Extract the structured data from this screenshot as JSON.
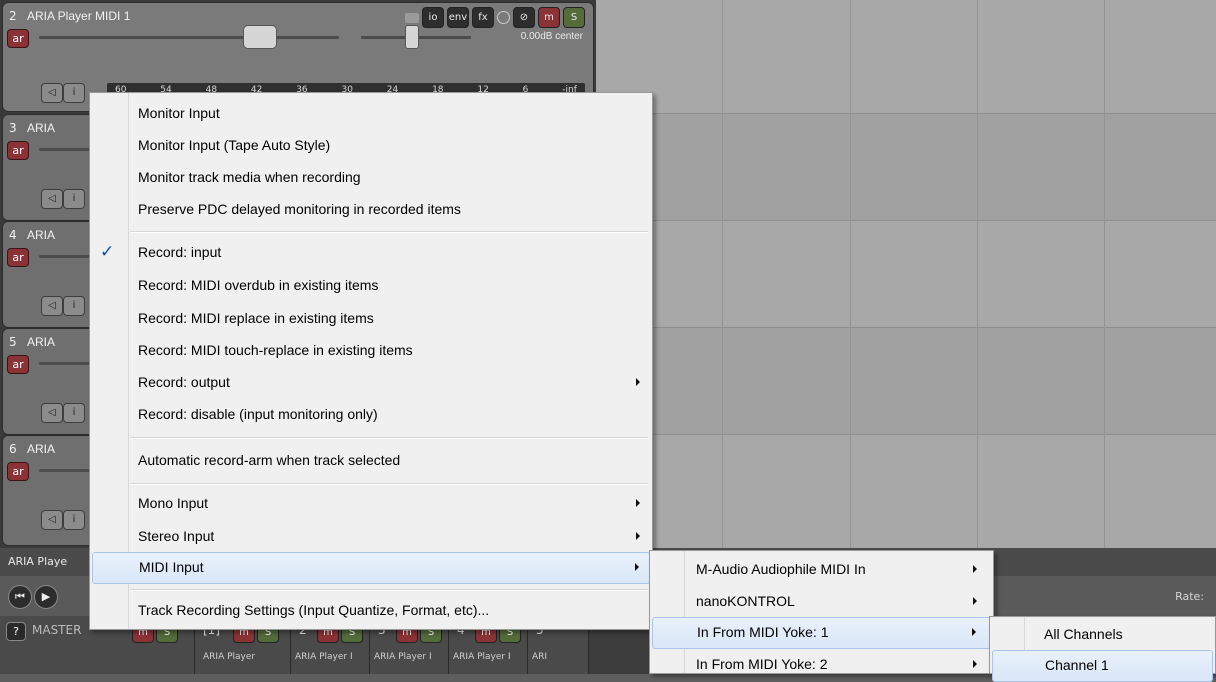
{
  "tracks": [
    {
      "num": "2",
      "name": "ARIA Player MIDI 1",
      "arm": "ar",
      "volpan": "0.00dB center",
      "buttons": {
        "io": "io",
        "env": "env",
        "fx": "fx",
        "mute": "m",
        "solo": "S"
      },
      "meter": [
        "60",
        "54",
        "48",
        "42",
        "36",
        "30",
        "24",
        "18",
        "12",
        "6",
        "-inf"
      ]
    },
    {
      "num": "3",
      "name": "ARIA",
      "arm": "ar"
    },
    {
      "num": "4",
      "name": "ARIA",
      "arm": "ar"
    },
    {
      "num": "5",
      "name": "ARIA",
      "arm": "ar"
    },
    {
      "num": "6",
      "name": "ARIA",
      "arm": "ar"
    }
  ],
  "fx_bar_label": "ARIA Playe",
  "transport": {
    "rate_label": "Rate:"
  },
  "mixer": {
    "help": "?",
    "master": "MASTER",
    "mute": "m",
    "solo": "S",
    "strips": [
      {
        "label": "[1]",
        "name": "ARIA Player"
      },
      {
        "label": "2",
        "name": "ARIA Player I"
      },
      {
        "label": "3",
        "name": "ARIA Player I"
      },
      {
        "label": "4",
        "name": "ARIA Player I"
      },
      {
        "label": "5",
        "name": "ARI"
      }
    ]
  },
  "context_menu": {
    "items": [
      {
        "label": "Monitor Input"
      },
      {
        "label": "Monitor Input (Tape Auto Style)"
      },
      {
        "label": "Monitor track media when recording"
      },
      {
        "label": "Preserve PDC delayed monitoring in recorded items"
      },
      {
        "label": "Record: input",
        "checked": true
      },
      {
        "label": "Record: MIDI overdub in existing items"
      },
      {
        "label": "Record: MIDI replace in existing items"
      },
      {
        "label": "Record: MIDI touch-replace in existing items"
      },
      {
        "label": "Record: output",
        "submenu": true
      },
      {
        "label": "Record: disable (input monitoring only)"
      },
      {
        "label": "Automatic record-arm when track selected"
      },
      {
        "label": "Mono Input",
        "submenu": true
      },
      {
        "label": "Stereo Input",
        "submenu": true
      },
      {
        "label": "MIDI Input",
        "submenu": true,
        "highlighted": true
      },
      {
        "label": "Track Recording Settings (Input Quantize, Format, etc)..."
      }
    ]
  },
  "midi_input_submenu": {
    "items": [
      {
        "label": "M-Audio Audiophile MIDI In",
        "submenu": true
      },
      {
        "label": "nanoKONTROL",
        "submenu": true
      },
      {
        "label": "In From MIDI Yoke:  1",
        "submenu": true,
        "highlighted": true
      },
      {
        "label": "In From MIDI Yoke:  2",
        "submenu": true
      }
    ]
  },
  "channel_submenu": {
    "items": [
      {
        "label": "All Channels"
      },
      {
        "label": "Channel 1",
        "highlighted": true
      }
    ]
  },
  "colors": {
    "menu_bg": "#f0f0f0",
    "highlight": "#d9e7f7",
    "checkmark": "#1a4f9c",
    "mute": "#8a3236",
    "solo": "#546b3a"
  }
}
